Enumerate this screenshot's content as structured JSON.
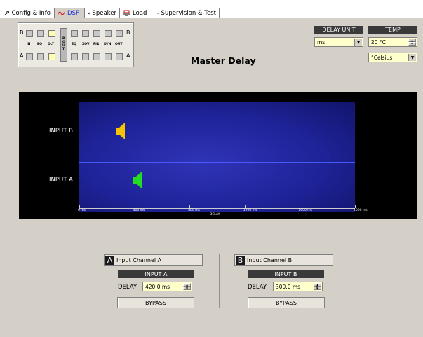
{
  "tabs": [
    {
      "label": "Config & Info",
      "icon": "wrench-icon"
    },
    {
      "label": "DSP",
      "icon": "dsp-curve-icon",
      "active": true
    },
    {
      "label": "Speaker",
      "icon": "speaker-icon"
    },
    {
      "label": "Load",
      "icon": "load-icon"
    },
    {
      "label": "Supervision & Test",
      "icon": "glasses-icon"
    }
  ],
  "routing": {
    "row_b": "B",
    "row_a": "A",
    "labels_left": [
      "IN",
      "EQ",
      "DLY"
    ],
    "rout": "R O U T",
    "labels_right": [
      "EQ",
      "XOV",
      "FIR",
      "DYN",
      "OUT"
    ]
  },
  "page_title": "Master Delay",
  "delay_unit": {
    "header": "DELAY UNIT",
    "value": "ms"
  },
  "temp": {
    "header": "TEMP",
    "value": "20 °C",
    "unit": "°Celsius"
  },
  "graph": {
    "row_b_label": "INPUT B",
    "row_a_label": "INPUT A",
    "axis_label": "DELAY",
    "ticks": [
      "0 ms",
      "400 ms",
      "800 ms",
      "1200 ms",
      "1600 ms",
      "2000 ms"
    ]
  },
  "chart_data": {
    "type": "scatter",
    "xlabel": "DELAY",
    "xlim": [
      0,
      2000
    ],
    "categories": [
      "INPUT B",
      "INPUT A"
    ],
    "series": [
      {
        "name": "INPUT B",
        "x": 300.0,
        "color": "#f5c400"
      },
      {
        "name": "INPUT A",
        "x": 420.0,
        "color": "#22dd22"
      }
    ]
  },
  "channel_a": {
    "badge": "A",
    "label": "Input Channel A",
    "input": "INPUT A",
    "delay_label": "DELAY",
    "delay_value": "420.0 ms",
    "bypass": "BYPASS"
  },
  "channel_b": {
    "badge": "B",
    "label": "Input Channel B",
    "input": "INPUT B",
    "delay_label": "DELAY",
    "delay_value": "300.0 ms",
    "bypass": "BYPASS"
  }
}
